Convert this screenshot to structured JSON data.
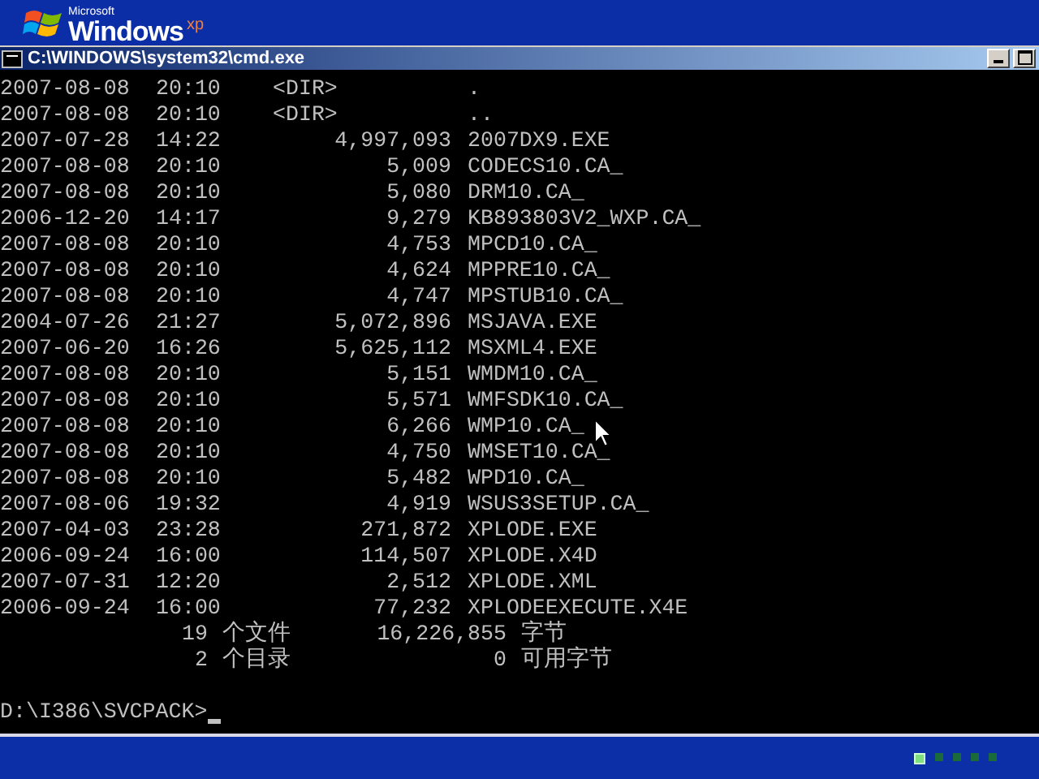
{
  "top_bar": {
    "logo": {
      "maker": "Microsoft",
      "name": "Windows",
      "edition": "xp"
    }
  },
  "window": {
    "title": "C:\\WINDOWS\\system32\\cmd.exe"
  },
  "console": {
    "rows": [
      {
        "kind": "dir",
        "date": "2007-08-08",
        "time": "20:10",
        "size": "<DIR>",
        "name": "."
      },
      {
        "kind": "dir",
        "date": "2007-08-08",
        "time": "20:10",
        "size": "<DIR>",
        "name": ".."
      },
      {
        "kind": "file",
        "date": "2007-07-28",
        "time": "14:22",
        "size": "4,997,093",
        "name": "2007DX9.EXE"
      },
      {
        "kind": "file",
        "date": "2007-08-08",
        "time": "20:10",
        "size": "5,009",
        "name": "CODECS10.CA_"
      },
      {
        "kind": "file",
        "date": "2007-08-08",
        "time": "20:10",
        "size": "5,080",
        "name": "DRM10.CA_"
      },
      {
        "kind": "file",
        "date": "2006-12-20",
        "time": "14:17",
        "size": "9,279",
        "name": "KB893803V2_WXP.CA_"
      },
      {
        "kind": "file",
        "date": "2007-08-08",
        "time": "20:10",
        "size": "4,753",
        "name": "MPCD10.CA_"
      },
      {
        "kind": "file",
        "date": "2007-08-08",
        "time": "20:10",
        "size": "4,624",
        "name": "MPPRE10.CA_"
      },
      {
        "kind": "file",
        "date": "2007-08-08",
        "time": "20:10",
        "size": "4,747",
        "name": "MPSTUB10.CA_"
      },
      {
        "kind": "file",
        "date": "2004-07-26",
        "time": "21:27",
        "size": "5,072,896",
        "name": "MSJAVA.EXE"
      },
      {
        "kind": "file",
        "date": "2007-06-20",
        "time": "16:26",
        "size": "5,625,112",
        "name": "MSXML4.EXE"
      },
      {
        "kind": "file",
        "date": "2007-08-08",
        "time": "20:10",
        "size": "5,151",
        "name": "WMDM10.CA_"
      },
      {
        "kind": "file",
        "date": "2007-08-08",
        "time": "20:10",
        "size": "5,571",
        "name": "WMFSDK10.CA_"
      },
      {
        "kind": "file",
        "date": "2007-08-08",
        "time": "20:10",
        "size": "6,266",
        "name": "WMP10.CA_"
      },
      {
        "kind": "file",
        "date": "2007-08-08",
        "time": "20:10",
        "size": "4,750",
        "name": "WMSET10.CA_"
      },
      {
        "kind": "file",
        "date": "2007-08-08",
        "time": "20:10",
        "size": "5,482",
        "name": "WPD10.CA_"
      },
      {
        "kind": "file",
        "date": "2007-08-06",
        "time": "19:32",
        "size": "4,919",
        "name": "WSUS3SETUP.CA_"
      },
      {
        "kind": "file",
        "date": "2007-04-03",
        "time": "23:28",
        "size": "271,872",
        "name": "XPLODE.EXE"
      },
      {
        "kind": "file",
        "date": "2006-09-24",
        "time": "16:00",
        "size": "114,507",
        "name": "XPLODE.X4D"
      },
      {
        "kind": "file",
        "date": "2007-07-31",
        "time": "12:20",
        "size": "2,512",
        "name": "XPLODE.XML"
      },
      {
        "kind": "file",
        "date": "2006-09-24",
        "time": "16:00",
        "size": "77,232",
        "name": "XPLODEEXECUTE.X4E"
      }
    ],
    "summary": [
      {
        "count": "19",
        "label": "个文件",
        "amount": "16,226,855",
        "unit": "字节"
      },
      {
        "count": "2",
        "label": "个目录",
        "amount": "0",
        "unit": "可用字节"
      }
    ],
    "prompt": "D:\\I386\\SVCPACK>"
  },
  "progress_dots": [
    {
      "on": true
    },
    {
      "on": false
    },
    {
      "on": false
    },
    {
      "on": false
    },
    {
      "on": false
    }
  ]
}
